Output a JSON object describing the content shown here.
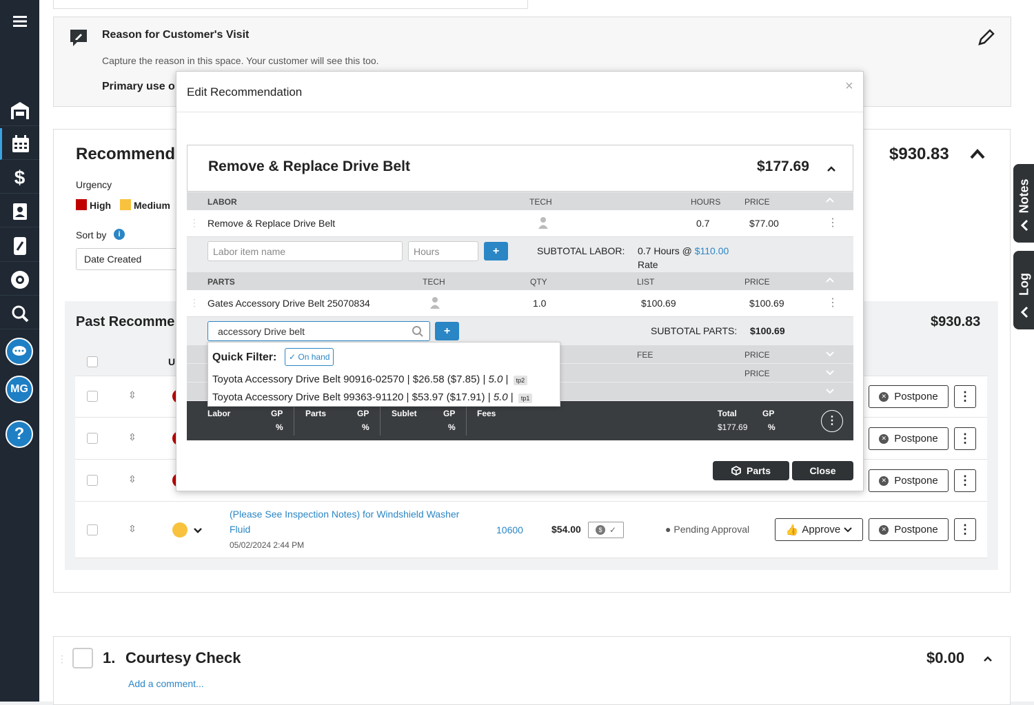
{
  "sidebar": {
    "user_initials": "MG"
  },
  "visit": {
    "title": "Reason for Customer's Visit",
    "description": "Capture the reason in this space. Your customer will see this too.",
    "primary_use": "Primary use o"
  },
  "recommendations": {
    "title": "Recommend",
    "total": "$930.83",
    "urgency_label": "Urgency",
    "urgency_high": "High",
    "urgency_medium": "Medium",
    "sort_label": "Sort by",
    "sort_value": "Date Created",
    "past_title": "Past Recomme",
    "past_total": "$930.83",
    "col_u": "U",
    "postpone_label": "Postpone",
    "last_row": {
      "desc_line1": "(Please See Inspection Notes) for Windshield Washer",
      "desc_line2": "Fluid",
      "date": "05/02/2024 2:44 PM",
      "number": "10600",
      "price": "$54.00",
      "status": "Pending Approval",
      "approve_label": "Approve"
    }
  },
  "courtesy": {
    "number": "1.",
    "title": "Courtesy Check",
    "total": "$0.00",
    "comment_link": "Add a comment..."
  },
  "side_tabs": {
    "notes": "Notes",
    "log": "Log"
  },
  "modal": {
    "title": "Edit Recommendation",
    "close_x": "×",
    "job_title": "Remove & Replace Drive Belt",
    "job_total": "$177.69",
    "labor": {
      "headers": {
        "name": "LABOR",
        "tech": "TECH",
        "hours": "HOURS",
        "price": "PRICE"
      },
      "row": {
        "name": "Remove & Replace Drive Belt",
        "hours": "0.7",
        "price": "$77.00"
      },
      "name_placeholder": "Labor item name",
      "hours_placeholder": "Hours",
      "subtotal_label": "SUBTOTAL LABOR:",
      "subtotal_hours": "0.7 Hours @",
      "rate_value": "$110.00",
      "rate_label": "Rate"
    },
    "parts": {
      "headers": {
        "name": "PARTS",
        "tech": "TECH",
        "qty": "QTY",
        "list": "LIST",
        "price": "PRICE"
      },
      "row": {
        "name": "Gates Accessory Drive Belt 25070834",
        "qty": "1.0",
        "list": "$100.69",
        "price": "$100.69"
      },
      "search_value": "accessory Drive belt",
      "subtotal_label": "SUBTOTAL PARTS:",
      "subtotal_value": "$100.69"
    },
    "fees": {
      "fee": "FEE",
      "price": "PRICE"
    },
    "sublet": {
      "price": "PRICE"
    },
    "dropdown": {
      "filter_label": "Quick Filter:",
      "filter_chip": "✓ On hand",
      "results": [
        {
          "text": "Toyota Accessory Drive Belt 90916-02570 | $26.58 ($7.85) |",
          "rating": "5.0",
          "tag": "tp2"
        },
        {
          "text": "Toyota Accessory Drive Belt 99363-91120 | $53.97 ($17.91) |",
          "rating": "5.0",
          "tag": "tp1"
        }
      ]
    },
    "summary": {
      "labor": "Labor",
      "gp1": "GP",
      "pct1": "%",
      "parts": "Parts",
      "gp2": "GP",
      "pct2": "%",
      "sublet": "Sublet",
      "gp3": "GP",
      "pct3": "%",
      "fees": "Fees",
      "total_label": "Total",
      "total_value": "$177.69",
      "gp4": "GP",
      "pct4": "%"
    },
    "parts_button": "Parts",
    "close_button": "Close"
  }
}
